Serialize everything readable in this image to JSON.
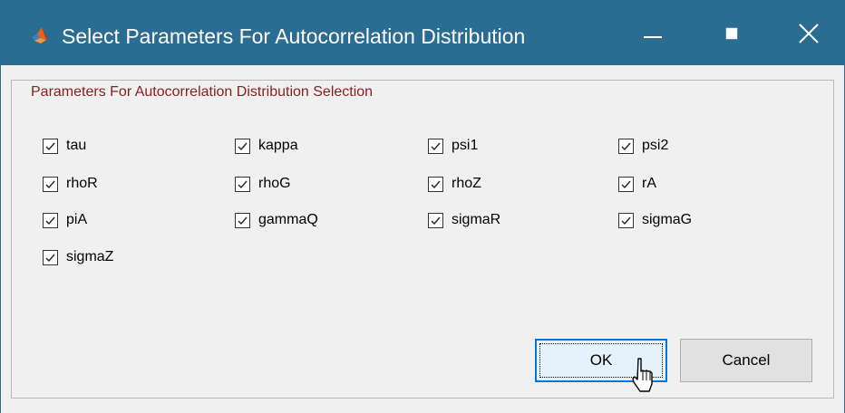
{
  "window": {
    "title": "Select Parameters For Autocorrelation Distribution",
    "icon": "matlab-icon",
    "controls": {
      "minimize": "minimize-icon",
      "maximize": "maximize-icon",
      "close": "close-icon"
    }
  },
  "group": {
    "title": "Parameters For Autocorrelation Distribution Selection"
  },
  "parameters": [
    {
      "label": "tau",
      "checked": true
    },
    {
      "label": "kappa",
      "checked": true
    },
    {
      "label": "psi1",
      "checked": true
    },
    {
      "label": "psi2",
      "checked": true
    },
    {
      "label": "rhoR",
      "checked": true
    },
    {
      "label": "rhoG",
      "checked": true
    },
    {
      "label": "rhoZ",
      "checked": true
    },
    {
      "label": "rA",
      "checked": true
    },
    {
      "label": "piA",
      "checked": true
    },
    {
      "label": "gammaQ",
      "checked": true
    },
    {
      "label": "sigmaR",
      "checked": true
    },
    {
      "label": "sigmaG",
      "checked": true
    },
    {
      "label": "sigmaZ",
      "checked": true
    }
  ],
  "buttons": {
    "ok_label": "OK",
    "cancel_label": "Cancel"
  },
  "colors": {
    "titlebar": "#2b6c93",
    "group_title": "#8a1d1d",
    "focus_border": "#0078d7"
  }
}
